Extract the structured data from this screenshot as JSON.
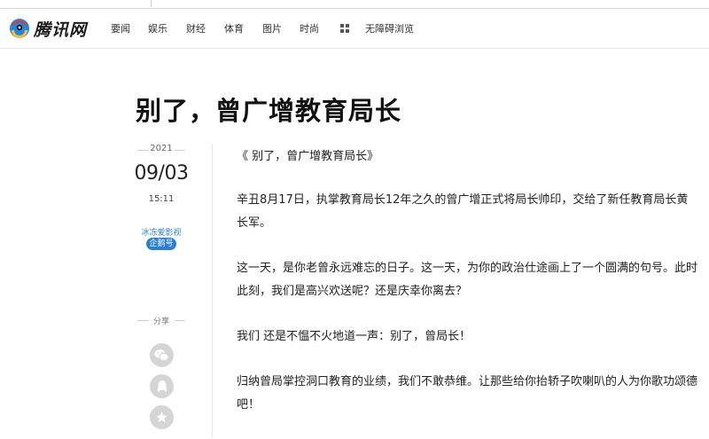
{
  "site": {
    "logo_text": "腾讯网"
  },
  "nav": {
    "items": [
      "要闻",
      "娱乐",
      "财经",
      "体育",
      "图片",
      "时尚"
    ],
    "accessible_label": "无障碍浏览"
  },
  "article": {
    "title": "别了，曾广增教育局长",
    "date": {
      "year": "2021",
      "month_day": "09/03",
      "time": "15:11"
    },
    "author": "冰冻爱影视",
    "badge": "企鹅号",
    "share_label": "分享",
    "paragraphs": [
      "《 别了，曾广增教育局长》",
      "辛丑8月17日，执掌教育局长12年之久的曾广增正式将局长帅印，交给了新任教育局长黄长军。",
      "这一天，是你老曾永远难忘的日子。这一天，为你的政治仕途画上了一个圆满的句号。此时此刻，我们是高兴欢送呢？还是庆幸你离去？",
      "我们 还是不愠不火地道一声：别了，曾局长！",
      "归纳曾局掌控洞口教育的业绩，我们不敢恭维。让那些给你抬轿子吹喇叭的人为你歌功颂德吧！"
    ]
  },
  "share_icons": [
    "wechat-icon",
    "qq-icon",
    "favorite-star-icon"
  ],
  "colors": {
    "accent_blue": "#2a7fd4",
    "share_icon_bg": "#d5d5d5"
  }
}
